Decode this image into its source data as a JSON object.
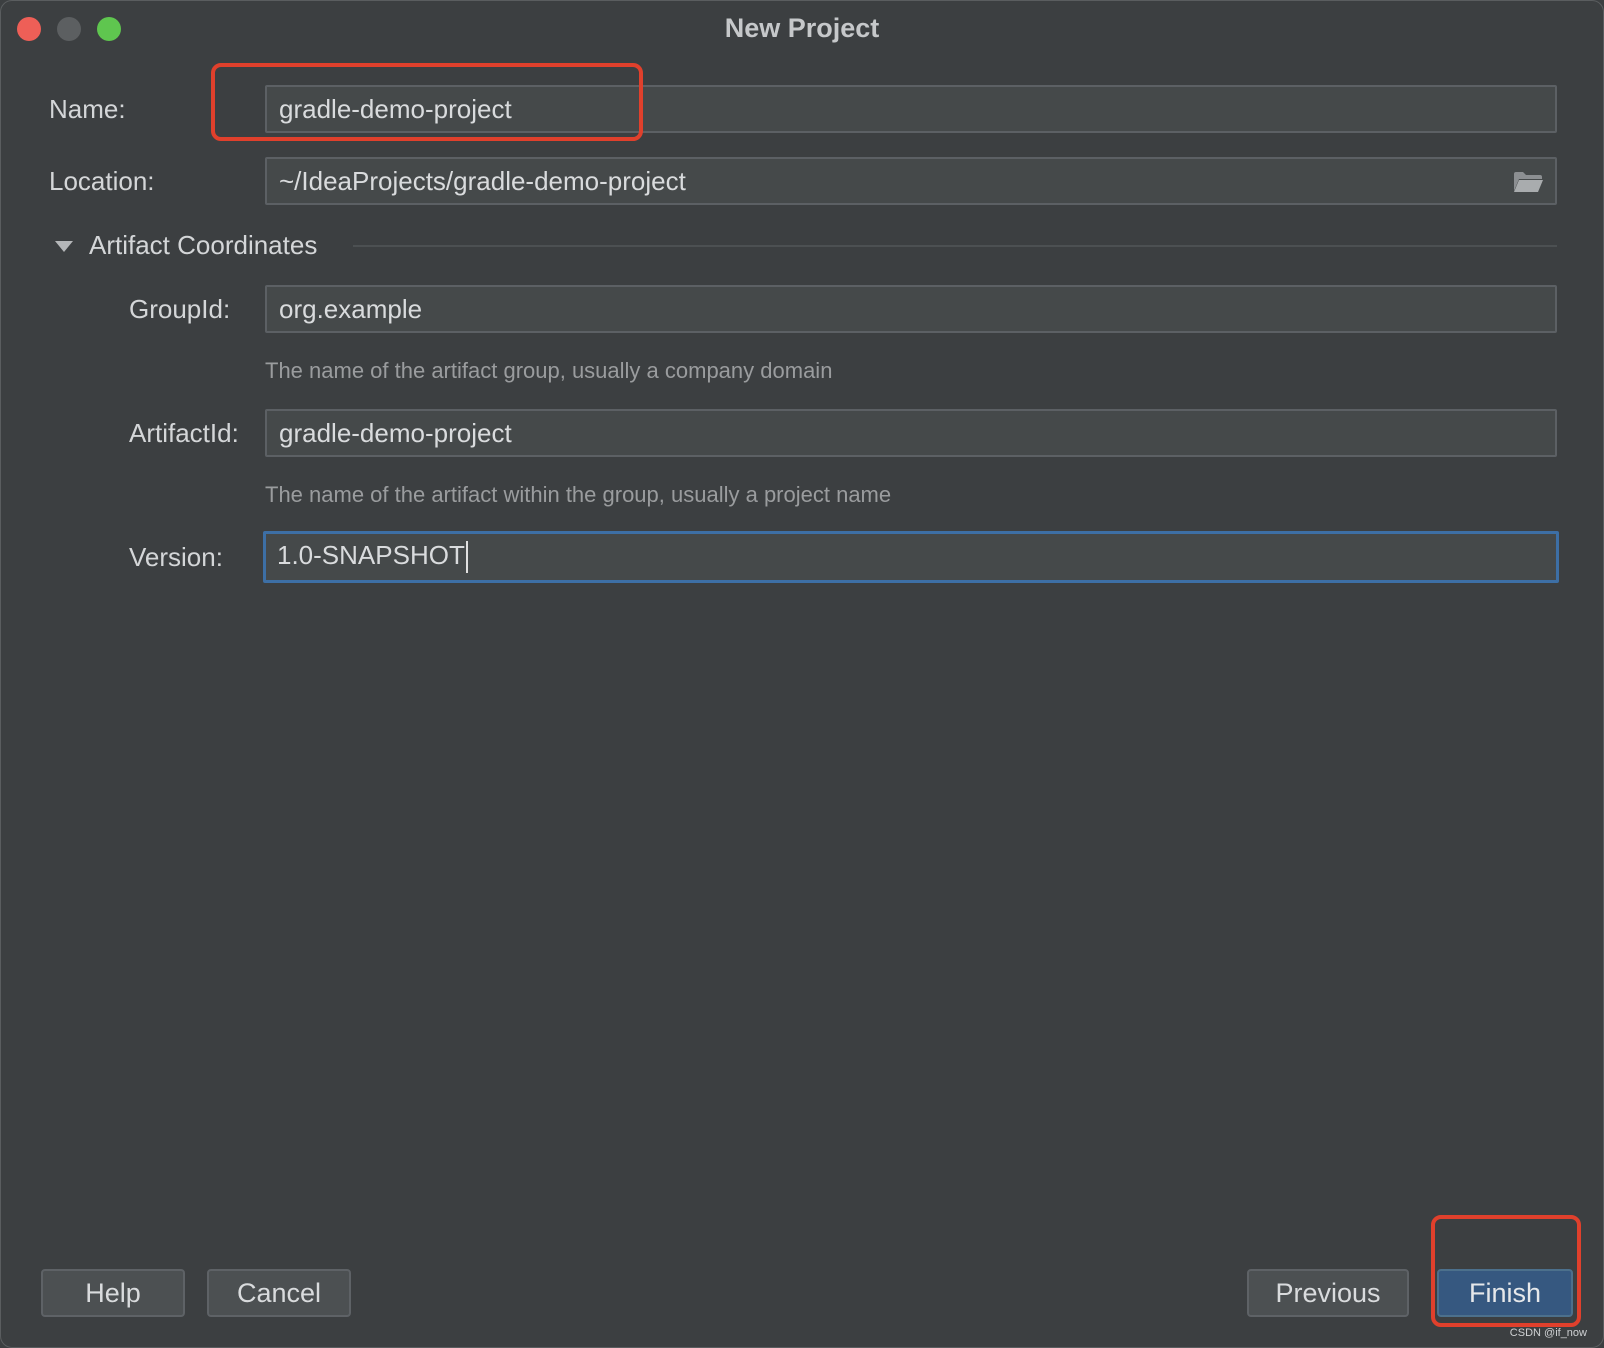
{
  "window": {
    "title": "New Project"
  },
  "form": {
    "name_label": "Name:",
    "name_value": "gradle-demo-project",
    "location_label": "Location:",
    "location_value": "~/IdeaProjects/gradle-demo-project",
    "section_title": "Artifact Coordinates",
    "groupid_label": "GroupId:",
    "groupid_value": "org.example",
    "groupid_hint": "The name of the artifact group, usually a company domain",
    "artifactid_label": "ArtifactId:",
    "artifactid_value": "gradle-demo-project",
    "artifactid_hint": "The name of the artifact within the group, usually a project name",
    "version_label": "Version:",
    "version_value": "1.0-SNAPSHOT"
  },
  "buttons": {
    "help": "Help",
    "cancel": "Cancel",
    "previous": "Previous",
    "finish": "Finish"
  },
  "icons": {
    "folder": "folder-icon",
    "section_toggle": "triangle-down-icon"
  },
  "colors": {
    "background": "#3c3f41",
    "field_bg": "#45494a",
    "focus_border": "#3d6fa5",
    "primary_button": "#365880",
    "annotation": "#e0402c"
  },
  "watermark": "CSDN @if_now"
}
